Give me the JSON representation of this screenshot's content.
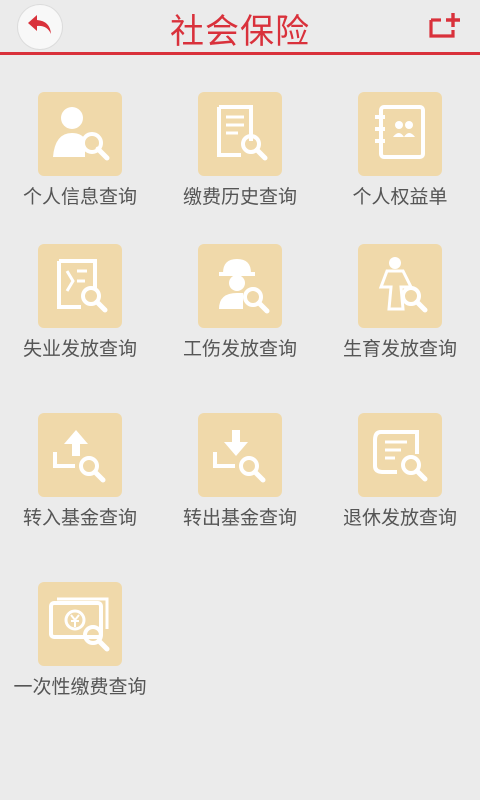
{
  "header": {
    "title": "社会保险",
    "back_icon": "back-arrow-icon",
    "add_icon": "add-shortcut-icon",
    "accent_color": "#d9313b"
  },
  "menu": {
    "tile_color": "#f0d9aa",
    "items": [
      {
        "label": "个人信息查询",
        "icon": "person-search-icon"
      },
      {
        "label": "缴费历史查询",
        "icon": "receipt-search-icon"
      },
      {
        "label": "个人权益单",
        "icon": "rights-book-icon"
      },
      {
        "label": "失业发放查询",
        "icon": "unemployment-search-icon"
      },
      {
        "label": "工伤发放查询",
        "icon": "worker-search-icon"
      },
      {
        "label": "生育发放查询",
        "icon": "maternity-search-icon"
      },
      {
        "label": "转入基金查询",
        "icon": "transfer-in-search-icon"
      },
      {
        "label": "转出基金查询",
        "icon": "transfer-out-search-icon"
      },
      {
        "label": "退休发放查询",
        "icon": "retirement-search-icon"
      },
      {
        "label": "一次性缴费查询",
        "icon": "one-time-payment-search-icon"
      }
    ]
  }
}
